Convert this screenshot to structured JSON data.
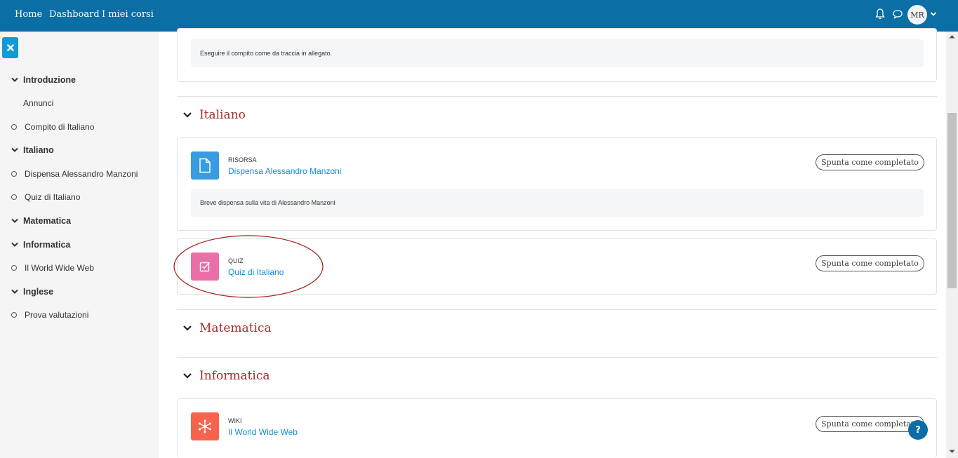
{
  "navbar": {
    "links": [
      "Home",
      "Dashboard",
      "I miei corsi"
    ],
    "avatar_initials": "MR"
  },
  "drawer": {
    "items": [
      {
        "label": "Introduzione",
        "kind": "section"
      },
      {
        "label": "Annunci",
        "kind": "plain"
      },
      {
        "label": "Compito di Italiano",
        "kind": "activity"
      },
      {
        "label": "Italiano",
        "kind": "section"
      },
      {
        "label": "Dispensa Alessandro Manzoni",
        "kind": "activity"
      },
      {
        "label": "Quiz di Italiano",
        "kind": "activity"
      },
      {
        "label": "Matematica",
        "kind": "section"
      },
      {
        "label": "Informatica",
        "kind": "section"
      },
      {
        "label": "Il World Wide Web",
        "kind": "activity"
      },
      {
        "label": "Inglese",
        "kind": "section"
      },
      {
        "label": "Prova valutazioni",
        "kind": "activity"
      }
    ]
  },
  "main": {
    "prev_activity": {
      "description": "Eseguire il compito come da traccia in allegato."
    },
    "sections": [
      {
        "title": "Italiano"
      },
      {
        "title": "Matematica"
      },
      {
        "title": "Informatica"
      }
    ],
    "activities": [
      {
        "type": "RISORSA",
        "name": "Dispensa Alessandro Manzoni",
        "button": "Spunta come completato",
        "description": "Breve dispensa sulla vita di Alessandro Manzoni",
        "icon": "file-icon",
        "color": "#399be2"
      },
      {
        "type": "QUIZ",
        "name": "Quiz di Italiano",
        "button": "Spunta come completato",
        "icon": "quiz-checkbox-icon",
        "color": "#e96fa6"
      },
      {
        "type": "WIKI",
        "name": "Il World Wide Web",
        "button": "Spunta come completato",
        "icon": "wiki-network-icon",
        "color": "#f7634d"
      }
    ]
  },
  "help_button": "?",
  "colors": {
    "navbar": "#0b6ea5",
    "section_title": "#a32d2d",
    "link": "#0f8ed4",
    "highlight": "#a01d1d"
  }
}
